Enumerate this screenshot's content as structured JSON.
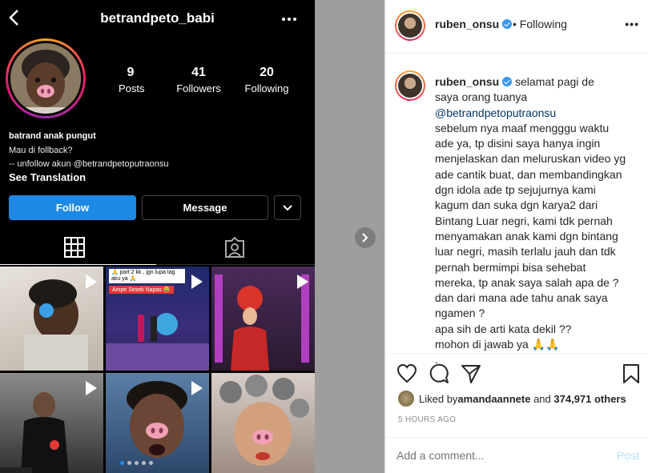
{
  "profile": {
    "username": "betrandpeto_babi",
    "stats": [
      {
        "num": "9",
        "label": "Posts"
      },
      {
        "num": "41",
        "label": "Followers"
      },
      {
        "num": "20",
        "label": "Following"
      }
    ],
    "bio_name": "batrand anak pungut",
    "bio_lines": [
      "Mau di follback?",
      "-- unfollow akun @betrandpetoputraonsu"
    ],
    "see_translation": "See Translation",
    "follow_label": "Follow",
    "message_label": "Message",
    "tile_captions": {
      "part2": "🙏 part 2 kk , jgn lupa tag aku ya 🙏",
      "ampe": "Ampe Sesek Napas 😂"
    }
  },
  "post": {
    "author": "ruben_onsu",
    "follow_status": "• Following",
    "caption_author": "ruben_onsu",
    "caption_lines": [
      " selamat pagi de",
      "saya orang tuanya",
      "@betrandpetoputraonsu",
      "sebelum nya maaf mengggu waktu",
      "ade ya, tp disini saya hanya ingin",
      "menjelaskan dan meluruskan video yg",
      "ade cantik buat, dan membandingkan",
      "dgn idola ade tp sejujurnya kami",
      "kagum dan suka dgn karya2 dari",
      "Bintang Luar negri, kami tdk pernah",
      "menyamakan anak kami dgn bintang",
      "luar negri, masih terlalu jauh dan tdk",
      "pernah bermimpi bisa sehebat",
      "mereka, tp anak saya salah apa de ?",
      "dan dari mana ade tahu anak saya",
      "ngamen ?",
      "apa sih de arti kata dekil ??",
      "mohon di jawab ya 🙏🙏",
      "."
    ],
    "liked_prefix": "Liked by ",
    "liked_user": "amandaannete",
    "liked_mid": " and ",
    "liked_count": "374,971 others",
    "time_ago": "5 HOURS AGO",
    "comment_placeholder": "Add a comment...",
    "post_label": "Post"
  },
  "colors": {
    "accent": "#1e88e5",
    "link": "#00376b",
    "verified": "#3897f0"
  }
}
